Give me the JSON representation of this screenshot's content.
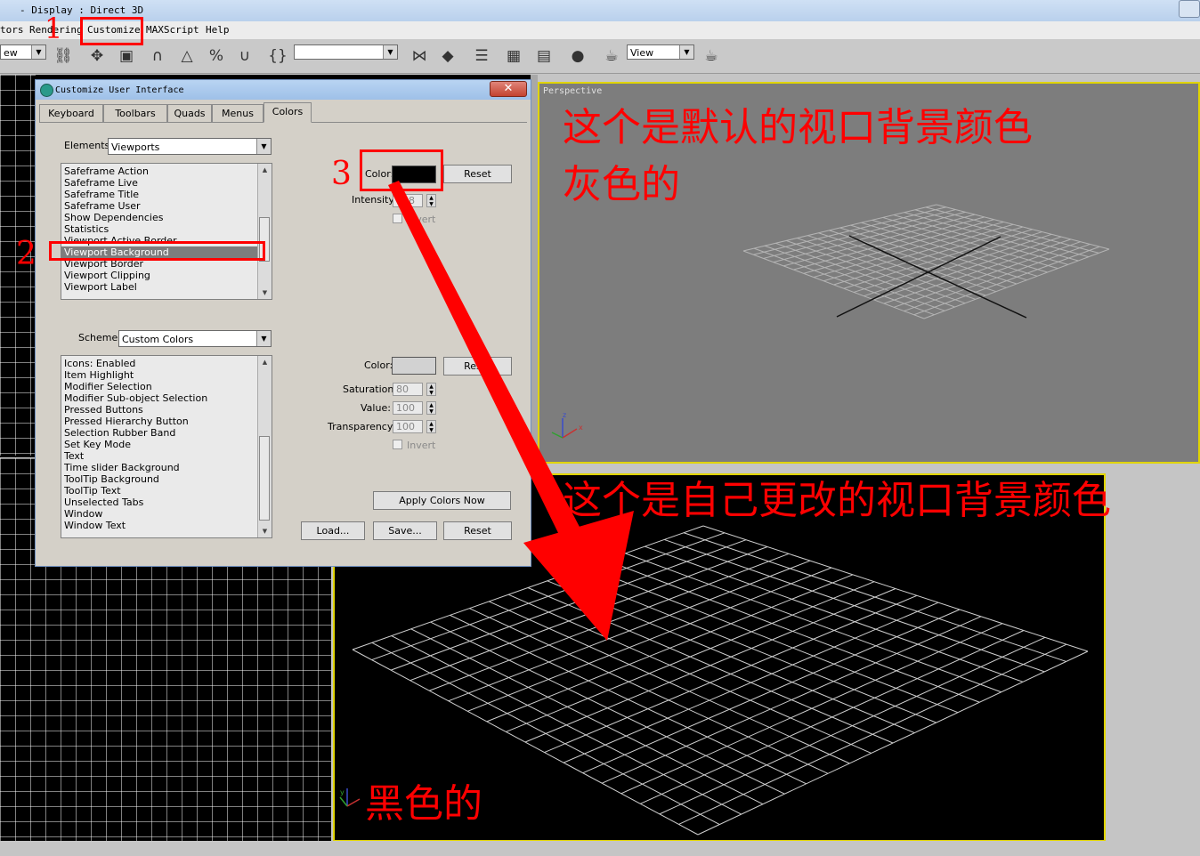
{
  "window": {
    "title": "- Display : Direct 3D"
  },
  "menubar": {
    "items": [
      "tors",
      "Rendering",
      "Customize",
      "MAXScript",
      "Help"
    ]
  },
  "toolbar": {
    "view_left": "ew",
    "view_combo": "View"
  },
  "dialog": {
    "title": "Customize User Interface",
    "close": "✕",
    "tabs": [
      "Keyboard",
      "Toolbars",
      "Quads",
      "Menus",
      "Colors"
    ],
    "elements_label": "Elements:",
    "elements_value": "Viewports",
    "elements_list": [
      "Safeframe Action",
      "Safeframe Live",
      "Safeframe Title",
      "Safeframe User",
      "Show Dependencies",
      "Statistics",
      "Viewport Active Border",
      "Viewport Background",
      "Viewport Border",
      "Viewport Clipping",
      "Viewport Label"
    ],
    "selected_element": "Viewport Background",
    "color_label": "Color:",
    "color_value": "#000000",
    "reset_label": "Reset",
    "intensity_label": "Intensity:",
    "intensity_value": "158",
    "invert_label": "Invert",
    "scheme_label": "Scheme:",
    "scheme_value": "Custom Colors",
    "scheme_list": [
      "Icons: Enabled",
      "Item Highlight",
      "Modifier Selection",
      "Modifier Sub-object Selection",
      "Pressed Buttons",
      "Pressed Hierarchy Button",
      "Selection Rubber Band",
      "Set Key Mode",
      "Text",
      "Time slider Background",
      "ToolTip Background",
      "ToolTip Text",
      "Unselected Tabs",
      "Window",
      "Window Text"
    ],
    "scheme_color_label": "Color:",
    "scheme_color_value": "#d2d2d2",
    "scheme_reset_label": "Reset",
    "saturation_label": "Saturation:",
    "saturation_value": "80",
    "value_label": "Value:",
    "value_value": "100",
    "transparency_label": "Transparency:",
    "transparency_value": "100",
    "scheme_invert_label": "Invert",
    "apply_label": "Apply Colors Now",
    "load_label": "Load...",
    "save_label": "Save...",
    "bottom_reset_label": "Reset"
  },
  "viewports": {
    "top_right_label": "Perspective",
    "axis_z": "z",
    "axis_x": "x",
    "axis_y": "y"
  },
  "annotations": {
    "num1": "1",
    "num2": "2",
    "num3": "3",
    "note_top_line1": "这个是默认的视口背景颜色",
    "note_top_line2": "灰色的",
    "note_bottom": "这个是自己更改的视口背景颜色",
    "note_black": "黑色的",
    "color_red": "#ff0000"
  }
}
